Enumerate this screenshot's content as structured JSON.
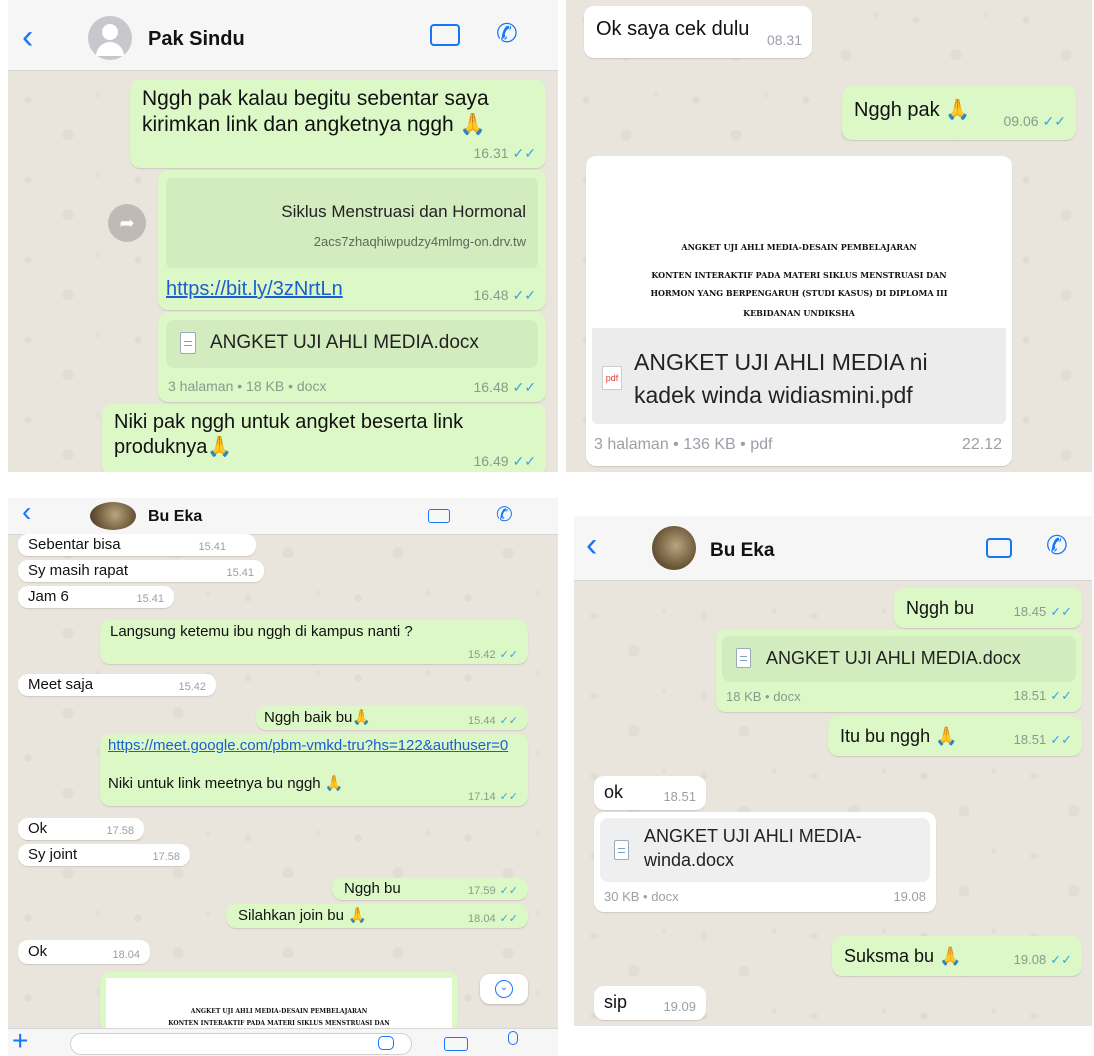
{
  "panel1": {
    "contact_name": "Pak Sindu",
    "msg1": {
      "text": "Nggh pak kalau begitu sebentar saya kirimkan link dan angketnya nggh",
      "time": "16.31"
    },
    "linkpreview": {
      "title": "Siklus Menstruasi dan Hormonal",
      "domain": "2acs7zhaqhiwpudzy4mlmg-on.drv.tw",
      "url": "https://bit.ly/3zNrtLn",
      "time": "16.48"
    },
    "doc": {
      "name": "ANGKET UJI AHLI MEDIA.docx",
      "info": "3 halaman • 18 KB • docx",
      "time": "16.48"
    },
    "msg2": {
      "text": "Niki pak nggh untuk angket beserta link produknya",
      "time": "16.49"
    }
  },
  "panel2": {
    "in1": {
      "text": "Ok saya cek dulu",
      "time": "08.31"
    },
    "out1": {
      "text": "Nggh pak",
      "time": "09.06"
    },
    "preview": [
      "ANGKET UJI AHLI MEDIA-DESAIN PEMBELAJARAN",
      "KONTEN INTERAKTIF PADA MATERI SIKLUS MENSTRUASI DAN",
      "HORMON YANG BERPENGARUH (STUDI KASUS) DI DIPLOMA III",
      "KEBIDANAN UNDIKSHA"
    ],
    "pdf_label": "pdf",
    "doc": {
      "name": "ANGKET UJI AHLI MEDIA ni kadek winda widiasmini.pdf",
      "info": "3 halaman • 136 KB • pdf",
      "time": "22.12"
    }
  },
  "panel3": {
    "contact_name": "Bu Eka",
    "m1": {
      "text": "Sebentar bisa",
      "time": "15.41"
    },
    "m2": {
      "text": "Sy masih rapat",
      "time": "15.41"
    },
    "m3": {
      "text": "Jam 6",
      "time": "15.41"
    },
    "m4": {
      "text": "Langsung ketemu ibu nggh di kampus nanti ?",
      "time": "15.42"
    },
    "m5": {
      "text": "Meet saja",
      "time": "15.42"
    },
    "m6": {
      "text": "Nggh baik bu",
      "time": "15.44"
    },
    "m7": {
      "url": "https://meet.google.com/pbm-vmkd-tru?hs=122&authuser=0",
      "text": "Niki untuk link meetnya bu nggh",
      "time": "17.14"
    },
    "m8": {
      "text": "Ok",
      "time": "17.58"
    },
    "m9": {
      "text": "Sy joint",
      "time": "17.58"
    },
    "m10": {
      "text": "Nggh bu",
      "time": "17.59"
    },
    "m11": {
      "text": "Silahkan join bu",
      "time": "18.04"
    },
    "m12": {
      "text": "Ok",
      "time": "18.04"
    },
    "preview": [
      "ANGKET UJI AHLI MEDIA-DESAIN PEMBELAJARAN",
      "KONTEN INTERAKTIF PADA MATERI SIKLUS MENSTRUASI DAN"
    ]
  },
  "panel4": {
    "contact_name": "Bu Eka",
    "m1": {
      "text": "Nggh bu",
      "time": "18.45"
    },
    "doc1": {
      "name": "ANGKET UJI AHLI MEDIA.docx",
      "info": "18 KB • docx",
      "time": "18.51"
    },
    "m2": {
      "text": "Itu bu nggh",
      "time": "18.51"
    },
    "m3": {
      "text": "ok",
      "time": "18.51"
    },
    "doc2": {
      "name": "ANGKET UJI AHLI MEDIA-winda.docx",
      "info": "30 KB • docx",
      "time": "19.08"
    },
    "m4": {
      "text": "Suksma bu",
      "time": "19.08"
    },
    "m5": {
      "text": "sip",
      "time": "19.09"
    }
  },
  "icons": {
    "back": "chevron-left-icon",
    "video": "video-camera-icon",
    "call": "phone-icon",
    "emoji": "folded-hands-icon",
    "ticks": "double-check-icon"
  },
  "colors": {
    "outgoing": "#dcf8c6",
    "incoming": "#ffffff",
    "accent": "#1477f8",
    "tick": "#34a6e6"
  }
}
